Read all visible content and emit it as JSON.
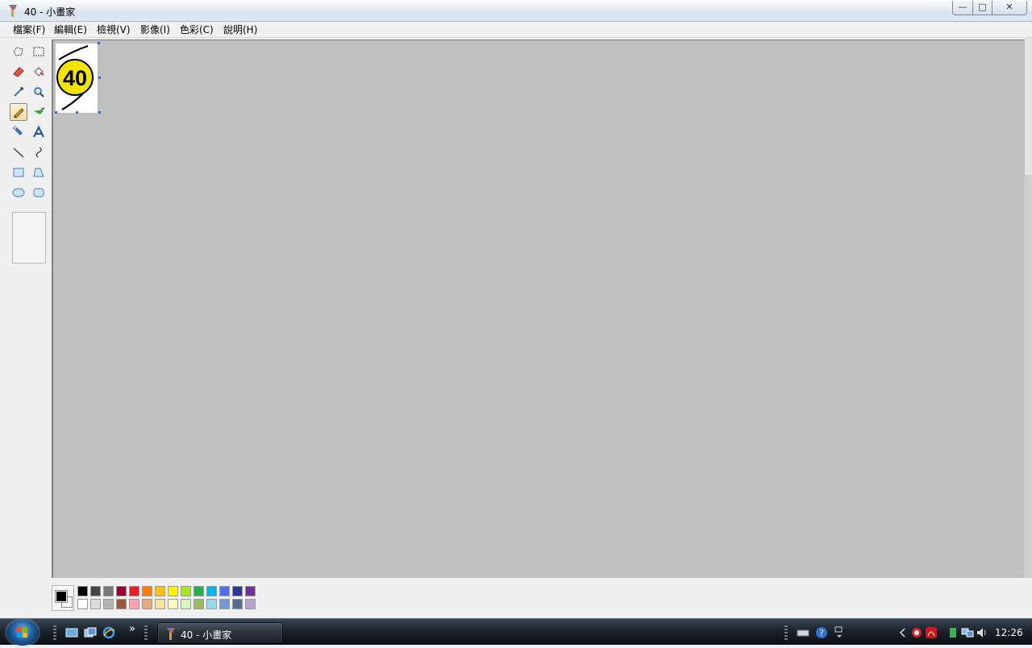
{
  "window": {
    "title": "40 - 小畫家",
    "controls": {
      "minimize": "—",
      "maximize": "□",
      "close": "✕"
    }
  },
  "menu": {
    "items": [
      "檔案(F)",
      "編輯(E)",
      "檢視(V)",
      "影像(I)",
      "色彩(C)",
      "說明(H)"
    ]
  },
  "tools": [
    "free-form-select",
    "select",
    "eraser",
    "fill-with-color",
    "pick-color",
    "magnifier",
    "pencil",
    "brush",
    "airbrush",
    "text",
    "line",
    "curve",
    "rectangle",
    "polygon",
    "ellipse",
    "rounded-rectangle"
  ],
  "selected_tool": "pencil",
  "image": {
    "content_text": "40",
    "badge_color": "#f2e600"
  },
  "palette": {
    "foreground": "#000000",
    "background": "#ffffff",
    "row1": [
      "#000000",
      "#464646",
      "#787878",
      "#990030",
      "#ed1c24",
      "#ff7e00",
      "#ffc20e",
      "#fff200",
      "#a8e61d",
      "#22b14c",
      "#00b7ef",
      "#4d6df3",
      "#2f3699",
      "#6f3198"
    ],
    "row2": [
      "#ffffff",
      "#dcdcdc",
      "#b4b4b4",
      "#9c5a3c",
      "#ffa3b1",
      "#e5aa7a",
      "#f5e49c",
      "#fff9bd",
      "#d3f9bc",
      "#9dbb61",
      "#99d9ea",
      "#709ad1",
      "#546d8e",
      "#b5a5d5"
    ]
  },
  "taskbar": {
    "task_label": "40 - 小畫家",
    "overflow": "»",
    "clock": "12:26"
  }
}
